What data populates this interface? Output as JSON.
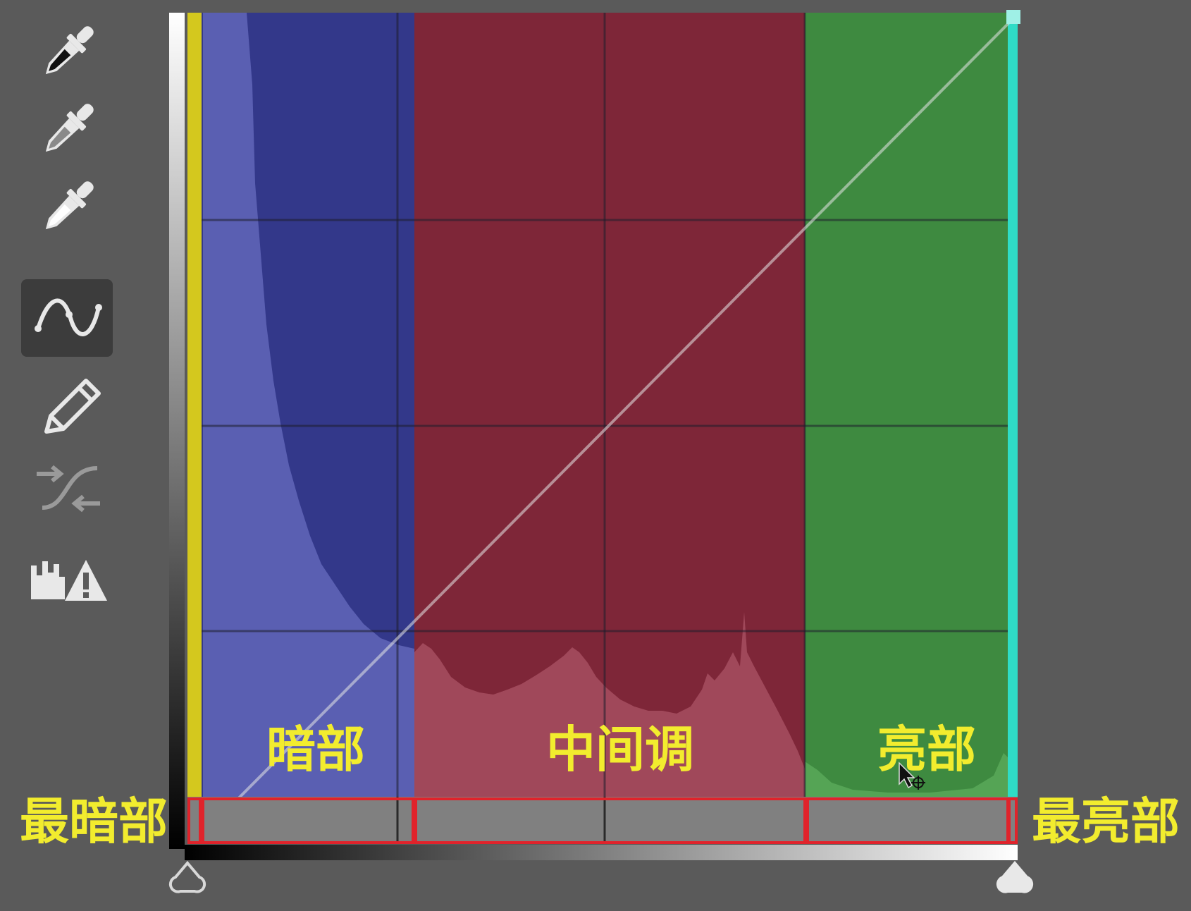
{
  "toolbar": {
    "tools": [
      {
        "name": "black-point-eyedropper-icon",
        "active": false
      },
      {
        "name": "gray-point-eyedropper-icon",
        "active": false
      },
      {
        "name": "white-point-eyedropper-icon",
        "active": false
      },
      {
        "name": "curve-tool-icon",
        "active": true
      },
      {
        "name": "pencil-tool-icon",
        "active": false
      },
      {
        "name": "smooth-curve-icon",
        "active": false
      },
      {
        "name": "clipping-warning-icon",
        "active": false
      }
    ]
  },
  "zones": {
    "shadows_label": "暗部",
    "midtones_label": "中间调",
    "highlights_label": "亮部",
    "darkest_label": "最暗部",
    "brightest_label": "最亮部"
  },
  "colors": {
    "background": "#5a5a5a",
    "shadows_zone": "#33388a",
    "midtones_zone": "#7e2638",
    "highlights_zone": "#3e8a40",
    "black_point_line": "#d4c81e",
    "white_point_line": "#2fdcc6",
    "annotation_text": "#f2ec2e",
    "annotation_box": "#e0232b"
  }
}
